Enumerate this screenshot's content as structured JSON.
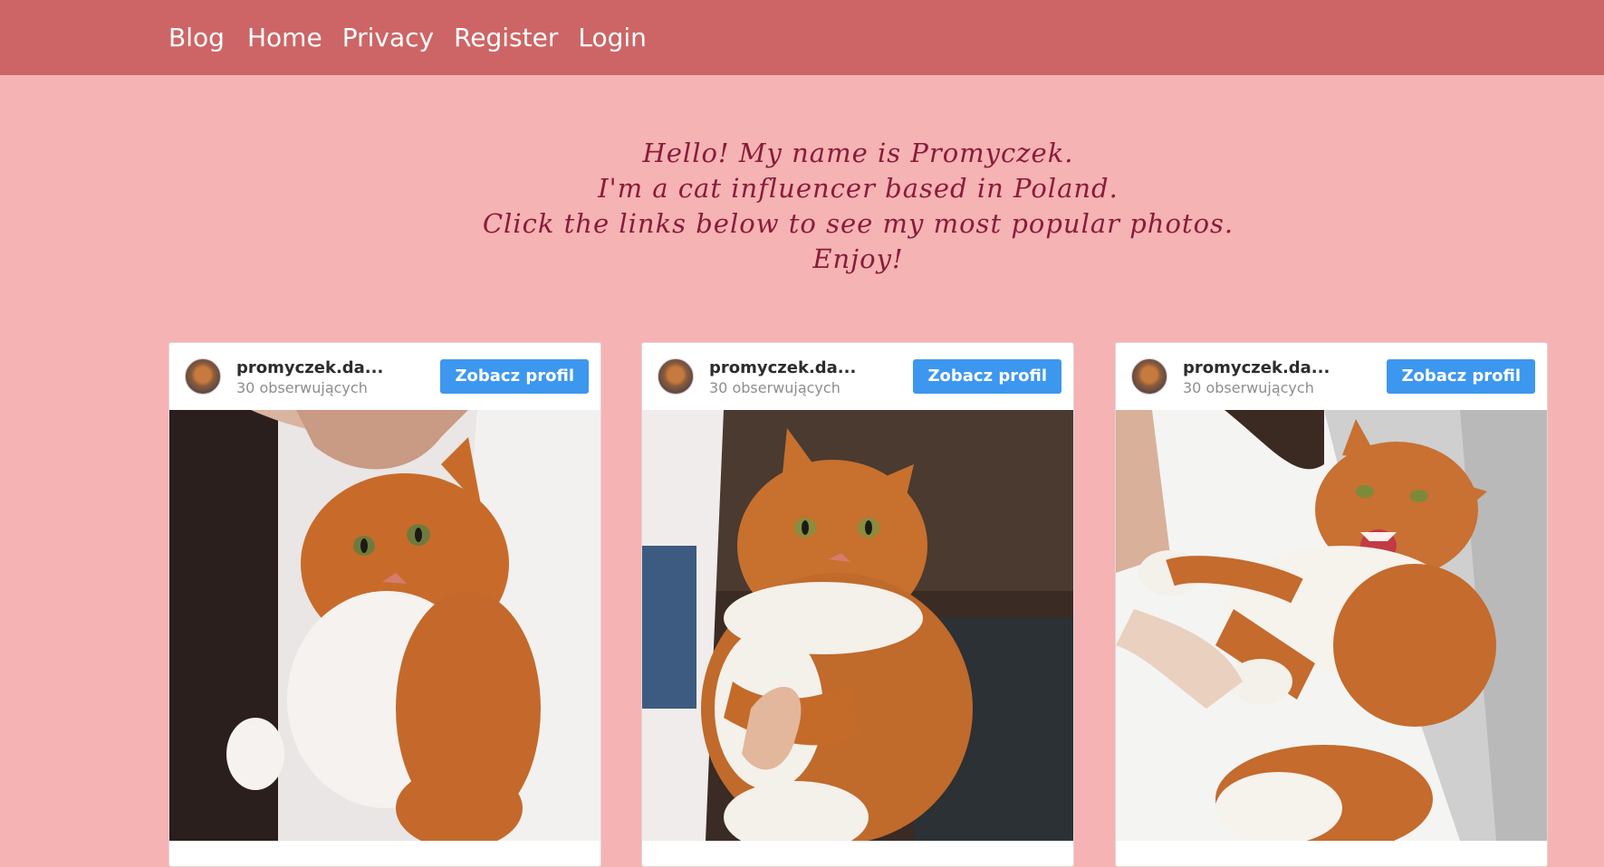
{
  "nav": {
    "brand": "Blog",
    "links": [
      "Home",
      "Privacy",
      "Register",
      "Login"
    ]
  },
  "intro": {
    "lines": [
      "Hello! My name is Promyczek.",
      "I'm a cat influencer based in Poland.",
      "Click the links below to see my most popular photos.",
      "Enjoy!"
    ]
  },
  "posts": [
    {
      "account": "promyczek.da...",
      "followers": "30 obserwujących",
      "button": "Zobacz profil",
      "photo_icon": "cat-photo-cuddle"
    },
    {
      "account": "promyczek.da...",
      "followers": "30 obserwujących",
      "button": "Zobacz profil",
      "photo_icon": "cat-photo-held"
    },
    {
      "account": "promyczek.da...",
      "followers": "30 obserwujących",
      "button": "Zobacz profil",
      "photo_icon": "cat-photo-hissing"
    }
  ],
  "colors": {
    "background": "#f5b3b4",
    "navbar": "#cd6566",
    "intro_text": "#8a1b3b",
    "button": "#3d97ee"
  }
}
